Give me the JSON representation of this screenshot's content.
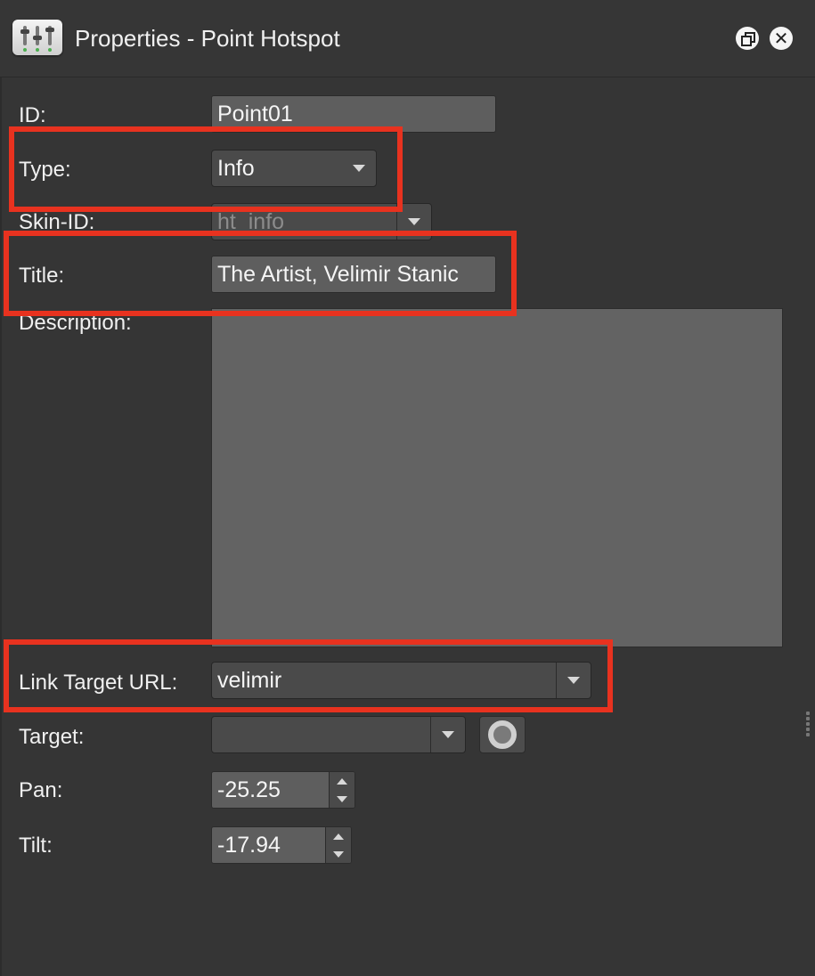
{
  "window": {
    "title": "Properties - Point Hotspot",
    "icon": "mixer-sliders-icon",
    "restore_icon": "restore-window-icon",
    "close_icon": "close-icon"
  },
  "form": {
    "id": {
      "label": "ID:",
      "value": "Point01"
    },
    "type": {
      "label": "Type:",
      "value": "Info"
    },
    "skin_id": {
      "label": "Skin-ID:",
      "value": "ht_info",
      "disabled": true
    },
    "title": {
      "label": "Title:",
      "value": "The Artist, Velimir Stanic"
    },
    "description": {
      "label": "Description:",
      "value": ""
    },
    "link_target_url": {
      "label": "Link Target URL:",
      "value": "velimir"
    },
    "target": {
      "label": "Target:",
      "value": "",
      "picker_icon": "target-icon"
    },
    "pan": {
      "label": "Pan:",
      "value": "-25.25"
    },
    "tilt": {
      "label": "Tilt:",
      "value": "-17.94"
    }
  },
  "annotation_color": "#e8321f",
  "colors": {
    "background": "#353535",
    "field": "#5e5e5e",
    "combo": "#4a4a4a",
    "text": "#f2f2f2"
  }
}
